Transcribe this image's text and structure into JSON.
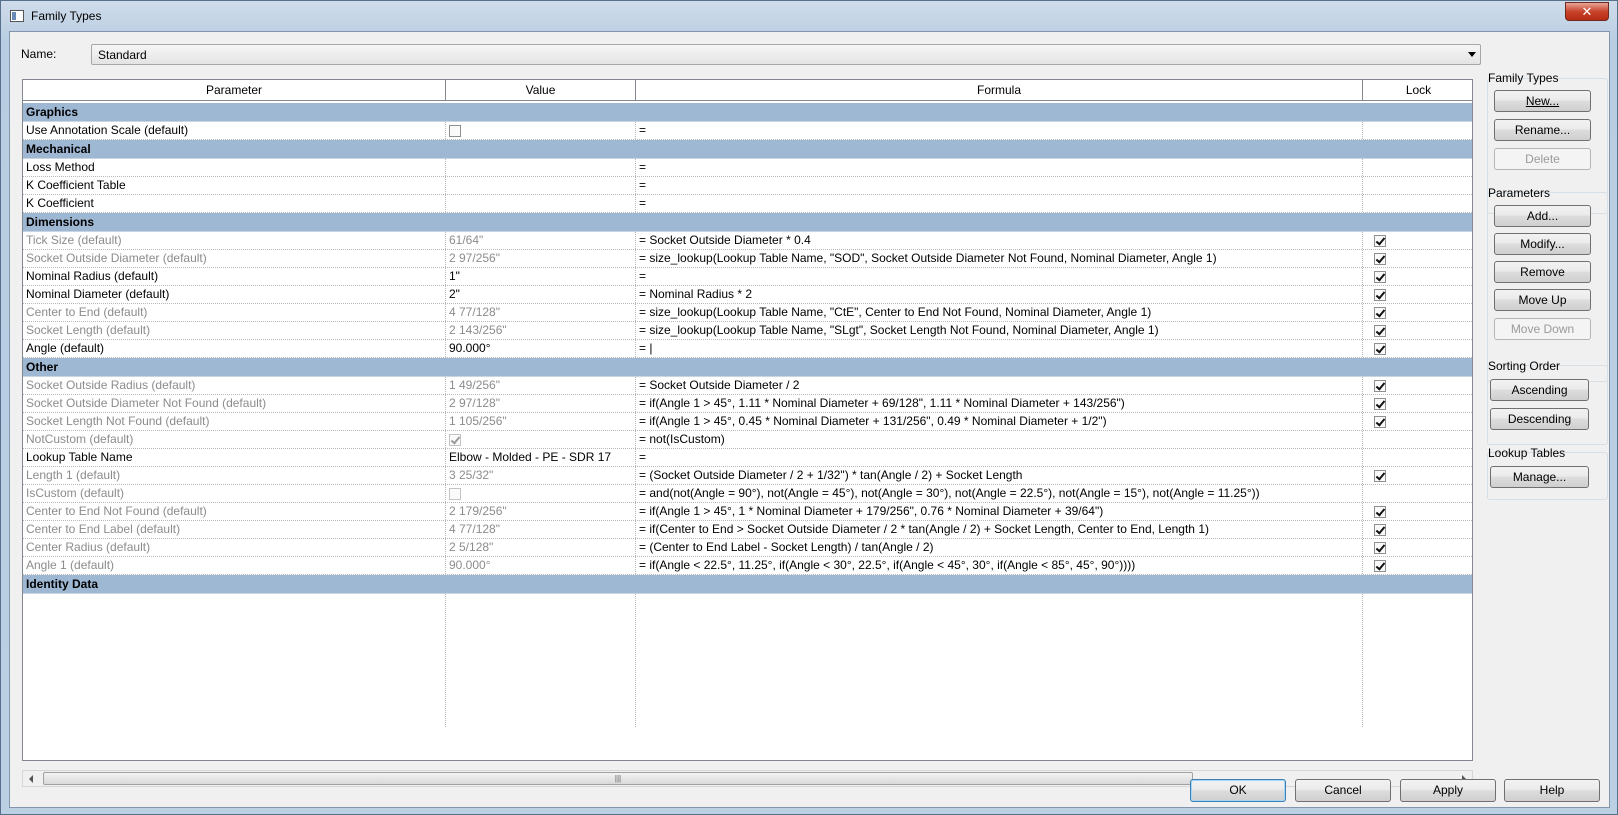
{
  "window": {
    "title": "Family Types",
    "close_glyph": "✕"
  },
  "name_field": {
    "label": "Name:",
    "value": "Standard"
  },
  "columns": {
    "parameter": "Parameter",
    "value": "Value",
    "formula": "Formula",
    "lock": "Lock"
  },
  "groups": {
    "graphics": "Graphics",
    "mechanical": "Mechanical",
    "dimensions": "Dimensions",
    "other": "Other",
    "identity": "Identity Data"
  },
  "rows": {
    "r0": {
      "param": "Use Annotation Scale (default)",
      "value": "",
      "formula": "="
    },
    "r1": {
      "param": "Loss Method",
      "value": "",
      "formula": "="
    },
    "r2": {
      "param": "K Coefficient Table",
      "value": "",
      "formula": "="
    },
    "r3": {
      "param": "K Coefficient",
      "value": "",
      "formula": "="
    },
    "r4": {
      "param": "Tick Size (default)",
      "value": "61/64\"",
      "formula": "= Socket Outside Diameter * 0.4"
    },
    "r5": {
      "param": "Socket Outside Diameter (default)",
      "value": "2 97/256\"",
      "formula": "= size_lookup(Lookup Table Name, \"SOD\", Socket Outside Diameter Not Found, Nominal Diameter, Angle 1)"
    },
    "r6": {
      "param": "Nominal Radius (default)",
      "value": "1\"",
      "formula": "="
    },
    "r7": {
      "param": "Nominal Diameter (default)",
      "value": "2\"",
      "formula": "= Nominal Radius * 2"
    },
    "r8": {
      "param": "Center to End (default)",
      "value": "4 77/128\"",
      "formula": "= size_lookup(Lookup Table Name, \"CtE\", Center to End Not Found, Nominal Diameter, Angle 1)"
    },
    "r9": {
      "param": "Socket Length (default)",
      "value": "2 143/256\"",
      "formula": "= size_lookup(Lookup Table Name, \"SLgt\", Socket Length Not Found, Nominal Diameter, Angle 1)"
    },
    "r10": {
      "param": "Angle (default)",
      "value": "90.000°",
      "formula": "= |"
    },
    "r11": {
      "param": "Socket Outside Radius (default)",
      "value": "1 49/256\"",
      "formula": "= Socket Outside Diameter / 2"
    },
    "r12": {
      "param": "Socket Outside Diameter Not Found (default)",
      "value": "2 97/128\"",
      "formula": "= if(Angle 1 > 45°, 1.11 * Nominal Diameter + 69/128\", 1.11 * Nominal Diameter + 143/256\")"
    },
    "r13": {
      "param": "Socket Length Not Found (default)",
      "value": "1 105/256\"",
      "formula": "= if(Angle 1 > 45°, 0.45 * Nominal Diameter + 131/256\", 0.49 * Nominal Diameter + 1/2\")"
    },
    "r14": {
      "param": "NotCustom (default)",
      "value": "",
      "formula": "= not(IsCustom)"
    },
    "r15": {
      "param": "Lookup Table Name",
      "value": "Elbow - Molded - PE - SDR 17",
      "formula": "="
    },
    "r16": {
      "param": "Length 1 (default)",
      "value": "3 25/32\"",
      "formula": "= (Socket Outside Diameter / 2 + 1/32\") * tan(Angle / 2) + Socket Length"
    },
    "r17": {
      "param": "IsCustom (default)",
      "value": "",
      "formula": "= and(not(Angle = 90°), not(Angle = 45°), not(Angle = 30°), not(Angle = 22.5°), not(Angle = 15°), not(Angle = 11.25°))"
    },
    "r18": {
      "param": "Center to End Not Found (default)",
      "value": "2 179/256\"",
      "formula": "= if(Angle 1 > 45°, 1 * Nominal Diameter + 179/256\", 0.76 * Nominal Diameter + 39/64\")"
    },
    "r19": {
      "param": "Center to End Label (default)",
      "value": "4 77/128\"",
      "formula": "= if(Center to End > Socket Outside Diameter / 2 * tan(Angle / 2) + Socket Length, Center to End, Length 1)"
    },
    "r20": {
      "param": "Center Radius (default)",
      "value": "2 5/128\"",
      "formula": "= (Center to End Label - Socket Length) / tan(Angle / 2)"
    },
    "r21": {
      "param": "Angle 1 (default)",
      "value": "90.000°",
      "formula": "= if(Angle < 22.5°, 11.25°, if(Angle < 30°, 22.5°, if(Angle < 45°, 30°, if(Angle < 85°, 45°, 90°))))"
    }
  },
  "side": {
    "family_types": {
      "label": "Family Types",
      "new": "New...",
      "rename": "Rename...",
      "delete": "Delete"
    },
    "parameters": {
      "label": "Parameters",
      "add": "Add...",
      "modify": "Modify...",
      "remove": "Remove",
      "move_up": "Move Up",
      "move_down": "Move Down"
    },
    "sorting": {
      "label": "Sorting Order",
      "ascending": "Ascending",
      "descending": "Descending"
    },
    "lookup": {
      "label": "Lookup Tables",
      "manage": "Manage..."
    }
  },
  "footer": {
    "ok": "OK",
    "cancel": "Cancel",
    "apply": "Apply",
    "help": "Help"
  },
  "scrollbar": {
    "grip": "|||"
  }
}
